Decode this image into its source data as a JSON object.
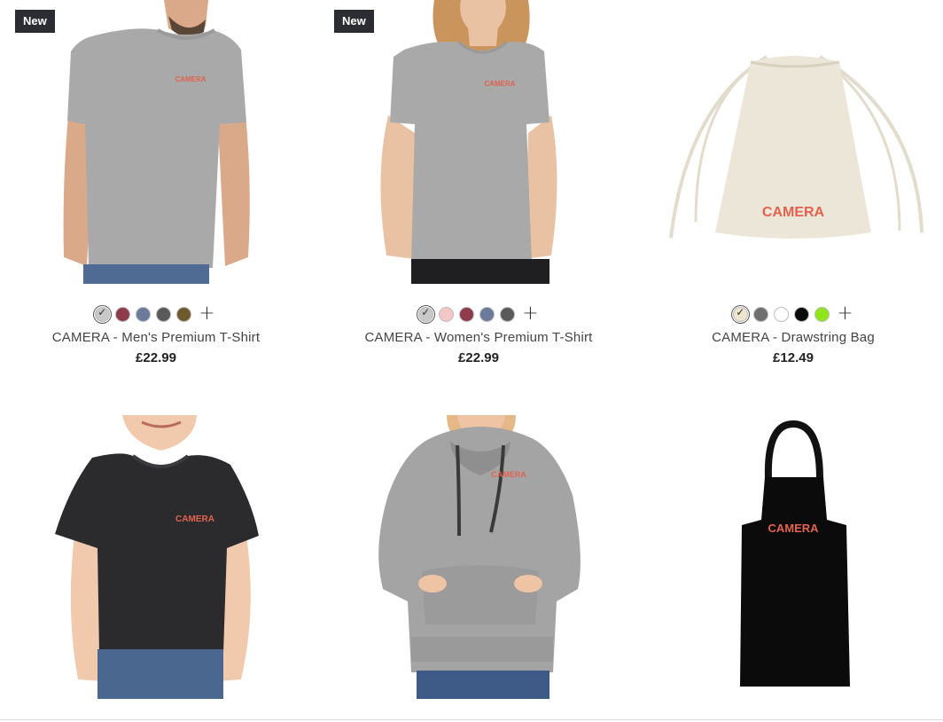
{
  "products": [
    {
      "badge": "New",
      "name": "CAMERA - Men's Premium T-Shirt",
      "price": "£22.99",
      "print": "CAMERA",
      "swatches": [
        "#c8c8c8",
        "#8e3b4c",
        "#6c7a9c",
        "#5a5a5a",
        "#6e5a2c"
      ],
      "selected_swatch": 0,
      "more": "+"
    },
    {
      "badge": "New",
      "name": "CAMERA - Women's Premium T-Shirt",
      "price": "£22.99",
      "print": "CAMERA",
      "swatches": [
        "#c8c8c8",
        "#f4c7c7",
        "#8e3b4c",
        "#6c7a9c",
        "#5a5a5a"
      ],
      "selected_swatch": 0,
      "more": "+"
    },
    {
      "badge": "",
      "name": "CAMERA - Drawstring Bag",
      "price": "£12.49",
      "print": "CAMERA",
      "swatches": [
        "#efe4cc",
        "#6f6f6f",
        "#ffffff",
        "#0a0a0a",
        "#8ee51a"
      ],
      "selected_swatch": 0,
      "more": "+"
    },
    {
      "badge": "",
      "print": "CAMERA"
    },
    {
      "badge": "",
      "print": "CAMERA"
    },
    {
      "badge": "",
      "print": "CAMERA"
    }
  ],
  "colors": {
    "print": "#e3624f",
    "badge_bg": "#2b2d33",
    "heather_grey": "#a9a9a9",
    "black_garment": "#2b2b2e"
  }
}
